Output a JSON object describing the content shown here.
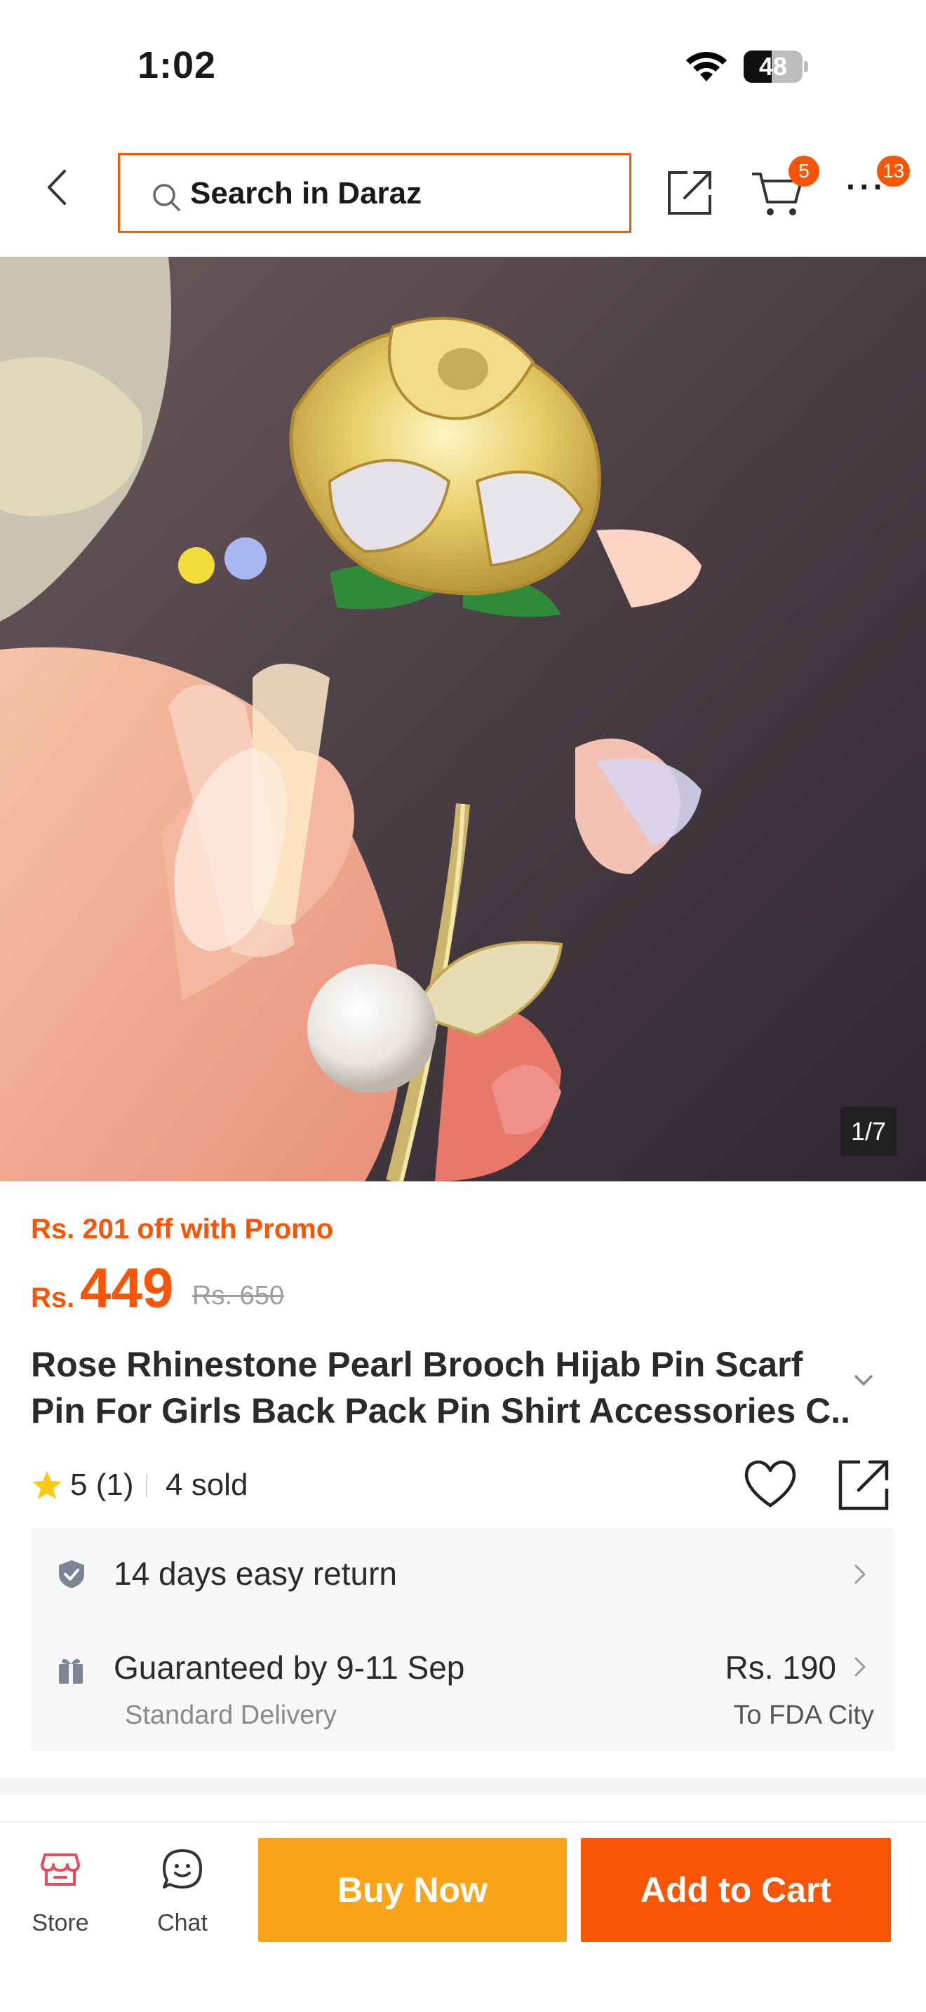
{
  "status_bar": {
    "time": "1:02",
    "battery": "48",
    "battery_level": 0.48
  },
  "header": {
    "search_placeholder": "Search in Daraz",
    "cart_badge": "5",
    "more_badge": "13"
  },
  "gallery": {
    "counter": "1/7"
  },
  "product": {
    "promo": "Rs. 201 off with Promo",
    "currency": "Rs.",
    "price": "449",
    "original_price": "Rs. 650",
    "title_line1": "Rose Rhinestone Pearl Brooch Hijab Pin Scarf",
    "title_line2": "Pin For Girls Back Pack Pin Shirt Accessories C...",
    "rating": "5",
    "review_count": "(1)",
    "sold": "4 sold"
  },
  "service": {
    "return_policy": "14 days easy return",
    "guarantee": "Guaranteed by 9-11 Sep",
    "delivery_type": "Standard Delivery",
    "delivery_fee": "Rs. 190",
    "location": "To FDA City"
  },
  "bottom_bar": {
    "store_label": "Store",
    "chat_label": "Chat",
    "buy_now_label": "Buy Now",
    "add_to_cart_label": "Add to Cart"
  },
  "colors": {
    "accent": "#f85606",
    "buy_now": "#faa41a",
    "store_icon": "#e84c5c"
  },
  "icons": [
    "back-icon",
    "search-icon",
    "share-icon",
    "cart-icon",
    "more-icon",
    "star-icon",
    "heart-icon",
    "shield-icon",
    "gift-icon",
    "chevron-right-icon",
    "chevron-down-icon",
    "store-icon",
    "chat-icon",
    "wifi-icon",
    "battery-icon"
  ]
}
